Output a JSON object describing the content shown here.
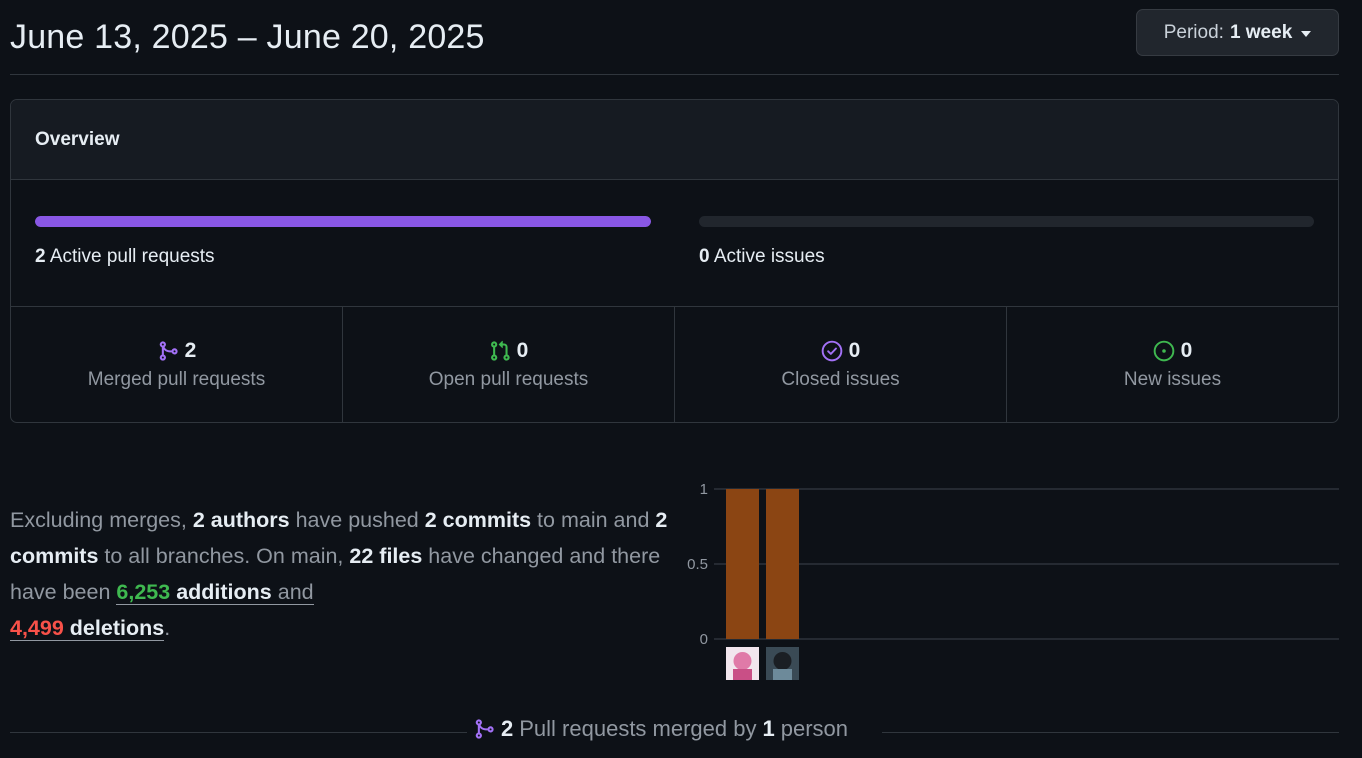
{
  "header": {
    "date_range": "June 13, 2025 – June 20, 2025",
    "period_button": {
      "prefix": "Period:",
      "value": "1 week"
    }
  },
  "overview": {
    "title": "Overview",
    "pull_requests_bar": {
      "count": "2",
      "label": "Active pull requests",
      "fraction": 1.0,
      "color": "#8957e5"
    },
    "issues_bar": {
      "count": "0",
      "label": "Active issues",
      "fraction": 0.0
    },
    "stats": [
      {
        "icon": "git-merge-icon",
        "color": "#a371f7",
        "value": "2",
        "label": "Merged pull requests"
      },
      {
        "icon": "git-pull-request-icon",
        "color": "#3fb950",
        "value": "0",
        "label": "Open pull requests"
      },
      {
        "icon": "issue-closed-icon",
        "color": "#a371f7",
        "value": "0",
        "label": "Closed issues"
      },
      {
        "icon": "issue-opened-icon",
        "color": "#3fb950",
        "value": "0",
        "label": "New issues"
      }
    ]
  },
  "summary": {
    "t1": "Excluding merges, ",
    "authors": "2 authors",
    "t2": " have pushed ",
    "commits_main": "2 commits",
    "t3": " to main and ",
    "commits_all": "2 commits",
    "t4": " to all branches. On main, ",
    "files": "22 files",
    "t5": " have changed and there have been ",
    "additions_num": "6,253",
    "additions_word": "additions",
    "t6": " and",
    "deletions_num": "4,499",
    "deletions_word": "deletions",
    "t7": "."
  },
  "chart_data": {
    "type": "bar",
    "categories": [
      "author-1",
      "author-2"
    ],
    "values": [
      1,
      1
    ],
    "yticks": [
      "1",
      "0.5",
      "0"
    ],
    "ylim": [
      0,
      1
    ],
    "bar_color": "#8b4513",
    "grid": true
  },
  "footer": {
    "count": "2",
    "t1": "Pull requests merged by",
    "persons": "1",
    "t2": "person"
  }
}
